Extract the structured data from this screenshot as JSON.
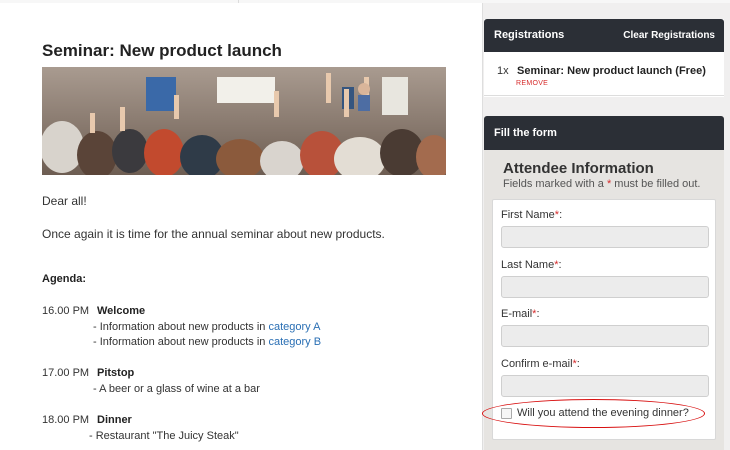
{
  "article": {
    "title": "Seminar: New product launch",
    "greeting": "Dear all!",
    "intro": "Once again it is time for the annual seminar about new products.",
    "agenda_heading": "Agenda:",
    "agenda": [
      {
        "time": "16.00 PM",
        "title": "Welcome",
        "lines": [
          {
            "text": "- Information about new products in ",
            "link": "category A"
          },
          {
            "text": "- Information about new products in ",
            "link": "category B"
          }
        ]
      },
      {
        "time": "17.00 PM",
        "title": "Pitstop",
        "lines": [
          {
            "text": "- A beer or a glass of wine at a bar",
            "link": ""
          }
        ]
      },
      {
        "time": "18.00 PM",
        "title": "Dinner",
        "lines": [
          {
            "text": "- Restaurant \"The Juicy Steak\"",
            "link": ""
          }
        ]
      }
    ]
  },
  "registrations": {
    "heading": "Registrations",
    "clear_label": "Clear Registrations",
    "items": [
      {
        "qty": "1x",
        "name": "Seminar: New product launch (Free)",
        "remove_label": "REMOVE"
      }
    ]
  },
  "form": {
    "heading": "Fill the form",
    "section_title": "Attendee Information",
    "note_prefix": "Fields marked with a ",
    "note_star": "*",
    "note_suffix": " must be filled out.",
    "fields": [
      {
        "label": "First Name",
        "star": "*",
        "colon": ":",
        "value": ""
      },
      {
        "label": "Last Name",
        "star": "*",
        "colon": ":",
        "value": ""
      },
      {
        "label": "E-mail",
        "star": "*",
        "colon": ":",
        "value": ""
      },
      {
        "label": "Confirm e-mail",
        "star": "*",
        "colon": ":",
        "value": ""
      }
    ],
    "dinner_checkbox_label": "Will you attend the evening dinner?",
    "dinner_checked": false
  },
  "colors": {
    "panel_header": "#2b2f36",
    "link": "#2a6fb4",
    "required": "#d62b2b",
    "annotation": "#d81010"
  }
}
